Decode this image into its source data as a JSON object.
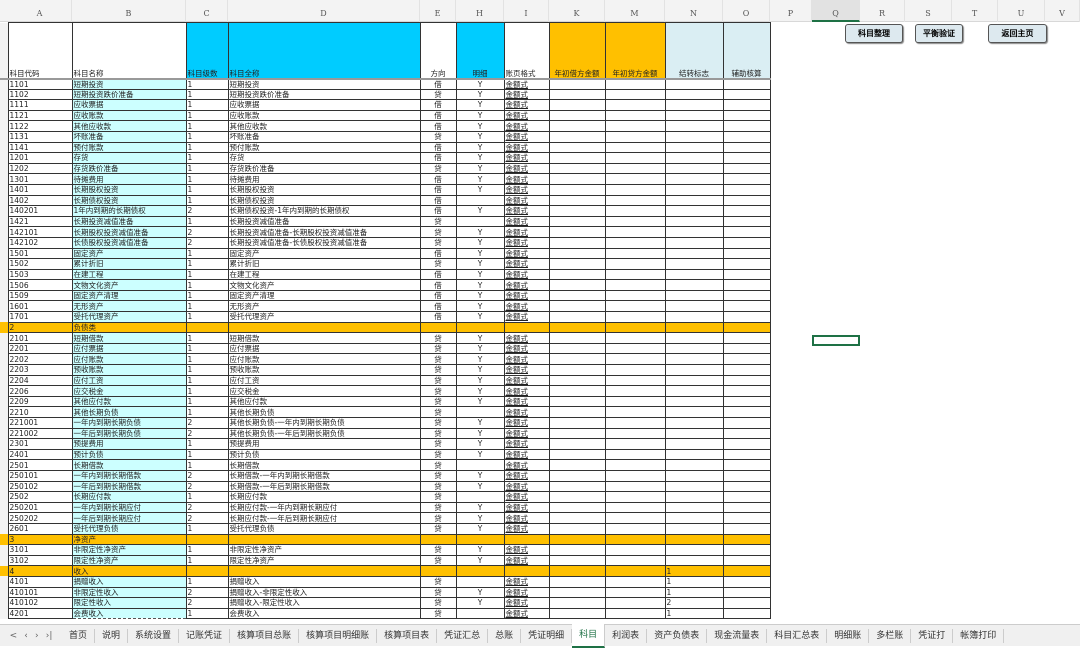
{
  "columns": [
    "A",
    "B",
    "C",
    "D",
    "E",
    "H",
    "I",
    "K",
    "M",
    "N",
    "O",
    "P",
    "Q",
    "R",
    "S",
    "T",
    "U",
    "V"
  ],
  "selected_column": "Q",
  "headers": {
    "A": "科目代码",
    "B": "科目名称",
    "C": "科目级数",
    "D": "科目全称",
    "E": "方向",
    "H": "明细",
    "I": "账页格式",
    "K": "年初借方金额",
    "M": "年初贷方金额",
    "N": "结转标志",
    "O": "辅助核算"
  },
  "buttons": {
    "organize": "科目整理",
    "balance": "平衡验证",
    "home": "返回主页"
  },
  "colors": {
    "header_cyan": "#00ccff",
    "header_orange": "#ffc000",
    "header_lightblue": "#daeef3",
    "category_row": "#ffc000",
    "name_column": "#ccffff",
    "selection": "#1e7145"
  },
  "rows": [
    [
      "1101",
      "短期投资",
      "1",
      "短期投资",
      "借",
      "Y",
      "金额式",
      ""
    ],
    [
      "1102",
      "短期投资跌价准备",
      "1",
      "短期投资跌价准备",
      "贷",
      "Y",
      "金额式",
      ""
    ],
    [
      "1111",
      "应收票据",
      "1",
      "应收票据",
      "借",
      "Y",
      "金额式",
      ""
    ],
    [
      "1121",
      "应收账款",
      "1",
      "应收账款",
      "借",
      "Y",
      "金额式",
      ""
    ],
    [
      "1122",
      "其他应收款",
      "1",
      "其他应收款",
      "借",
      "Y",
      "金额式",
      ""
    ],
    [
      "1131",
      "坏账准备",
      "1",
      "坏账准备",
      "贷",
      "Y",
      "金额式",
      ""
    ],
    [
      "1141",
      "预付账款",
      "1",
      "预付账款",
      "借",
      "Y",
      "金额式",
      ""
    ],
    [
      "1201",
      "存货",
      "1",
      "存货",
      "借",
      "Y",
      "金额式",
      ""
    ],
    [
      "1202",
      "存货跌价准备",
      "1",
      "存货跌价准备",
      "贷",
      "Y",
      "金额式",
      ""
    ],
    [
      "1301",
      "待摊费用",
      "1",
      "待摊费用",
      "借",
      "Y",
      "金额式",
      ""
    ],
    [
      "1401",
      "长期股权投资",
      "1",
      "长期股权投资",
      "借",
      "Y",
      "金额式",
      ""
    ],
    [
      "1402",
      "长期债权投资",
      "1",
      "长期债权投资",
      "借",
      "",
      "金额式",
      ""
    ],
    [
      "140201",
      "1年内到期的长期债权",
      "2",
      "长期债权投资-1年内到期的长期债权",
      "借",
      "Y",
      "金额式",
      ""
    ],
    [
      "1421",
      "长期投资减值准备",
      "1",
      "长期投资减值准备",
      "贷",
      "",
      "金额式",
      ""
    ],
    [
      "142101",
      "长期股权投资减值准备",
      "2",
      "长期投资减值准备-长期股权投资减值准备",
      "贷",
      "Y",
      "金额式",
      ""
    ],
    [
      "142102",
      "长债股权投资减值准备",
      "2",
      "长期投资减值准备-长债股权投资减值准备",
      "贷",
      "Y",
      "金额式",
      ""
    ],
    [
      "1501",
      "固定资产",
      "1",
      "固定资产",
      "借",
      "Y",
      "金额式",
      ""
    ],
    [
      "1502",
      "累计折旧",
      "1",
      "累计折旧",
      "贷",
      "Y",
      "金额式",
      ""
    ],
    [
      "1503",
      "在建工程",
      "1",
      "在建工程",
      "借",
      "Y",
      "金额式",
      ""
    ],
    [
      "1506",
      "文物文化资产",
      "1",
      "文物文化资产",
      "借",
      "Y",
      "金额式",
      ""
    ],
    [
      "1509",
      "固定资产清理",
      "1",
      "固定资产清理",
      "借",
      "Y",
      "金额式",
      ""
    ],
    [
      "1601",
      "无形资产",
      "1",
      "无形资产",
      "借",
      "Y",
      "金额式",
      ""
    ],
    [
      "1701",
      "受托代理资产",
      "1",
      "受托代理资产",
      "借",
      "Y",
      "金额式",
      ""
    ],
    [
      "2",
      "负债类",
      "",
      "",
      "",
      "",
      "",
      "",
      "cat"
    ],
    [
      "2101",
      "短期借款",
      "1",
      "短期借款",
      "贷",
      "Y",
      "金额式",
      ""
    ],
    [
      "2201",
      "应付票据",
      "1",
      "应付票据",
      "贷",
      "Y",
      "金额式",
      ""
    ],
    [
      "2202",
      "应付账款",
      "1",
      "应付账款",
      "贷",
      "Y",
      "金额式",
      ""
    ],
    [
      "2203",
      "预收账款",
      "1",
      "预收账款",
      "贷",
      "Y",
      "金额式",
      ""
    ],
    [
      "2204",
      "应付工资",
      "1",
      "应付工资",
      "贷",
      "Y",
      "金额式",
      ""
    ],
    [
      "2206",
      "应交税金",
      "1",
      "应交税金",
      "贷",
      "Y",
      "金额式",
      ""
    ],
    [
      "2209",
      "其他应付款",
      "1",
      "其他应付款",
      "贷",
      "Y",
      "金额式",
      ""
    ],
    [
      "2210",
      "其他长期负债",
      "1",
      "其他长期负债",
      "贷",
      "",
      "金额式",
      ""
    ],
    [
      "221001",
      "一年内到期长期负债",
      "2",
      "其他长期负债-一年内到期长期负债",
      "贷",
      "Y",
      "金额式",
      ""
    ],
    [
      "221002",
      "一年后到期长期负债",
      "2",
      "其他长期负债-一年后到期长期负债",
      "贷",
      "Y",
      "金额式",
      ""
    ],
    [
      "2301",
      "预提费用",
      "1",
      "预提费用",
      "贷",
      "Y",
      "金额式",
      ""
    ],
    [
      "2401",
      "预计负债",
      "1",
      "预计负债",
      "贷",
      "Y",
      "金额式",
      ""
    ],
    [
      "2501",
      "长期借款",
      "1",
      "长期借款",
      "贷",
      "",
      "金额式",
      ""
    ],
    [
      "250101",
      "一年内到期长期借款",
      "2",
      "长期借款-一年内到期长期借款",
      "贷",
      "Y",
      "金额式",
      ""
    ],
    [
      "250102",
      "一年后到期长期借款",
      "2",
      "长期借款-一年后到期长期借款",
      "贷",
      "Y",
      "金额式",
      ""
    ],
    [
      "2502",
      "长期应付款",
      "1",
      "长期应付款",
      "贷",
      "",
      "金额式",
      ""
    ],
    [
      "250201",
      "一年内到期长期应付",
      "2",
      "长期应付款-一年内到期长期应付",
      "贷",
      "Y",
      "金额式",
      ""
    ],
    [
      "250202",
      "一年后到期长期应付",
      "2",
      "长期应付款-一年后到期长期应付",
      "贷",
      "Y",
      "金额式",
      ""
    ],
    [
      "2601",
      "受托代理负债",
      "1",
      "受托代理负债",
      "贷",
      "Y",
      "金额式",
      ""
    ],
    [
      "3",
      "净资产",
      "",
      "",
      "",
      "",
      "",
      "",
      "cat"
    ],
    [
      "3101",
      "非限定性净资产",
      "1",
      "非限定性净资产",
      "贷",
      "Y",
      "金额式",
      ""
    ],
    [
      "3102",
      "限定性净资产",
      "1",
      "限定性净资产",
      "贷",
      "Y",
      "金额式",
      ""
    ],
    [
      "4",
      "收入",
      "",
      "",
      "",
      "",
      "",
      "1",
      "cat"
    ],
    [
      "4101",
      "捐赠收入",
      "1",
      "捐赠收入",
      "贷",
      "",
      "金额式",
      "1"
    ],
    [
      "410101",
      "非限定性收入",
      "2",
      "捐赠收入-非限定性收入",
      "贷",
      "Y",
      "金额式",
      "1"
    ],
    [
      "410102",
      "限定性收入",
      "2",
      "捐赠收入-限定性收入",
      "贷",
      "Y",
      "金额式",
      "2"
    ],
    [
      "4201",
      "会费收入",
      "1",
      "会费收入",
      "贷",
      "",
      "金额式",
      "1"
    ]
  ],
  "sheet_nav": [
    "<",
    "‹",
    "›",
    "›|"
  ],
  "tabs": [
    "首页",
    "说明",
    "系统设置",
    "记账凭证",
    "核算项目总账",
    "核算项目明细账",
    "核算项目表",
    "凭证汇总",
    "总账",
    "凭证明细",
    "科目",
    "利润表",
    "资产负债表",
    "现金流量表",
    "科目汇总表",
    "明细账",
    "多栏账",
    "凭证打",
    "帐簿打印"
  ],
  "active_tab": "科目"
}
